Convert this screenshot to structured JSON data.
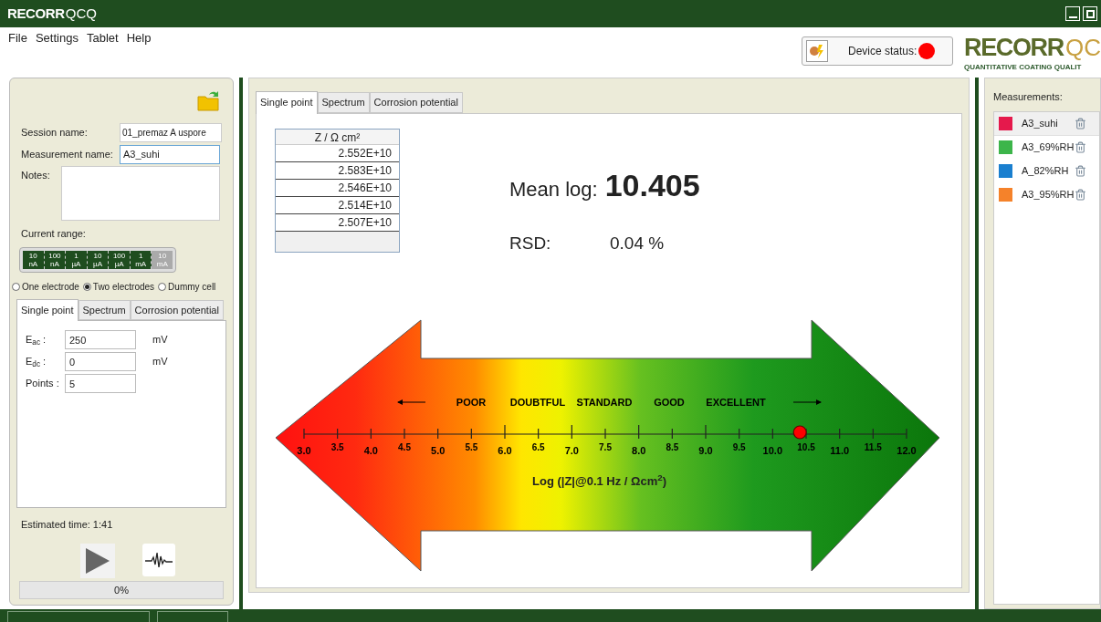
{
  "window": {
    "title_brand": "RECORR",
    "title_product": "QCQ"
  },
  "menu": [
    "File",
    "Settings",
    "Tablet",
    "Help"
  ],
  "device_status": {
    "label": "Device status:",
    "color": "#ff0000"
  },
  "logo": {
    "brand": "RECORR",
    "product": "QC",
    "tagline": "QUANTITATIVE COATING QUALIT"
  },
  "session": {
    "session_label": "Session name:",
    "session_value": "01_premaz A uspore",
    "measurement_label": "Measurement name:",
    "measurement_value": "A3_suhi",
    "notes_label": "Notes:"
  },
  "current_range": {
    "label": "Current range:",
    "segments": [
      {
        "value": "10",
        "unit": "nA",
        "on": true
      },
      {
        "value": "100",
        "unit": "nA",
        "on": true
      },
      {
        "value": "1",
        "unit": "µA",
        "on": true
      },
      {
        "value": "10",
        "unit": "µA",
        "on": true
      },
      {
        "value": "100",
        "unit": "µA",
        "on": true
      },
      {
        "value": "1",
        "unit": "mA",
        "on": true
      },
      {
        "value": "10",
        "unit": "mA",
        "on": false
      }
    ]
  },
  "electrodes": [
    {
      "label": "One electrode",
      "selected": false
    },
    {
      "label": "Two electrodes",
      "selected": true
    },
    {
      "label": "Dummy cell",
      "selected": false
    }
  ],
  "left_tabs": [
    {
      "label": "Single point",
      "selected": true
    },
    {
      "label": "Spectrum",
      "selected": false
    },
    {
      "label": "Corrosion potential",
      "selected": false
    }
  ],
  "params": [
    {
      "label": "E",
      "sub": "ac",
      "suffix": " :",
      "value": "250",
      "unit": "mV"
    },
    {
      "label": "E",
      "sub": "dc",
      "suffix": " :",
      "value": "0",
      "unit": "mV"
    },
    {
      "label": "Points :",
      "value": "5"
    }
  ],
  "estimated_time": "Estimated time: 1:41",
  "progress": {
    "text": "0%",
    "level": 0
  },
  "main_tabs": [
    {
      "label": "Single point",
      "selected": true
    },
    {
      "label": "Spectrum",
      "selected": false
    },
    {
      "label": "Corrosion potential",
      "selected": false
    }
  ],
  "table": {
    "column": "Z / Ω cm²",
    "rows": [
      "2.552E+10",
      "2.583E+10",
      "2.546E+10",
      "2.514E+10",
      "2.507E+10"
    ]
  },
  "mean_log": {
    "label": "Mean log:",
    "value": "10.405"
  },
  "rsd": {
    "label": "RSD:",
    "value": "0.04 %"
  },
  "scale": {
    "categories": [
      "POOR",
      "DOUBTFUL",
      "STANDARD",
      "GOOD",
      "EXCELLENT"
    ],
    "ticks": [
      "3.0",
      "3.5",
      "4.0",
      "4.5",
      "5.0",
      "5.5",
      "6.0",
      "6.5",
      "7.0",
      "7.5",
      "8.0",
      "8.5",
      "9.0",
      "9.5",
      "10.0",
      "10.5",
      "11.0",
      "11.5",
      "12.0"
    ],
    "axis_label": "Log (|Z|@0.1 Hz / Ωcm$^{2}$)",
    "level": 0.823
  },
  "measurements": {
    "label": "Measurements:",
    "items": [
      {
        "name": "A3_suhi",
        "color": "#e5194c",
        "selected": true
      },
      {
        "name": "A3_69%RH",
        "color": "#3cb54a",
        "selected": false
      },
      {
        "name": "A_82%RH",
        "color": "#1a7fcf",
        "selected": false
      },
      {
        "name": "A3_95%RH",
        "color": "#f5822a",
        "selected": false
      }
    ]
  }
}
